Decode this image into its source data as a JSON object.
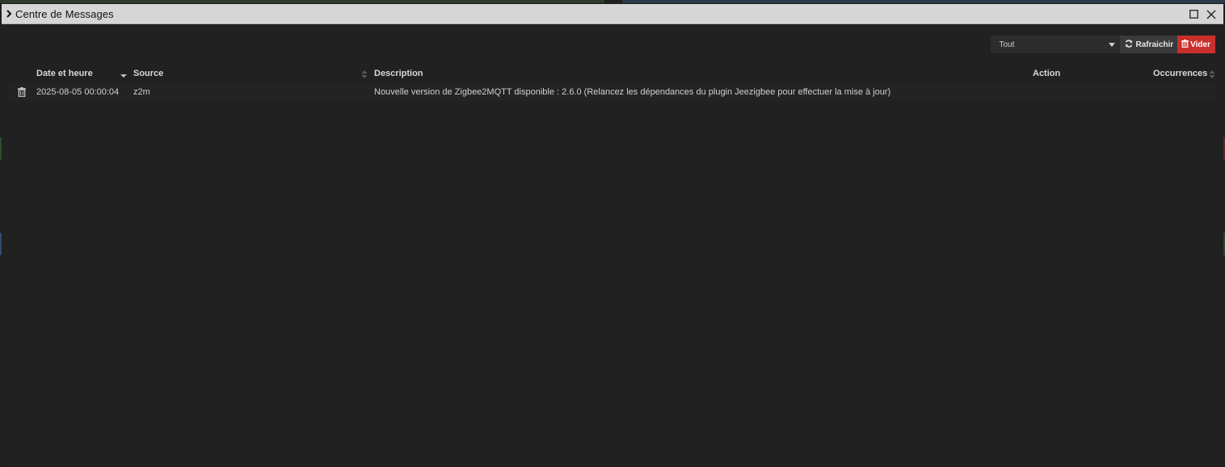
{
  "dialog": {
    "title": "Centre de Messages"
  },
  "toolbar": {
    "filter_value": "Tout",
    "refresh_label": "Rafraichir",
    "clear_label": "Vider"
  },
  "table": {
    "columns": [
      "Date et heure",
      "Source",
      "Description",
      "Action",
      "Occurrences"
    ],
    "rows": [
      {
        "date": "2025-08-05 00:00:04",
        "source": "z2m",
        "description": "Nouvelle version de Zigbee2MQTT disponible : 2.6.0 (Relancez les dépendances du plugin Jeezigbee pour effectuer la mise à jour)",
        "action": "",
        "occurrences": ""
      }
    ]
  },
  "colors": {
    "background": "#212121",
    "titlebar": "#d6d6d6",
    "danger": "#c9302c"
  },
  "icons": {
    "title_chevron": "chevron-right-icon",
    "maximize": "maximize-icon",
    "close": "close-icon",
    "refresh": "refresh-icon",
    "clear": "trash-icon",
    "row_delete": "trash-icon"
  }
}
